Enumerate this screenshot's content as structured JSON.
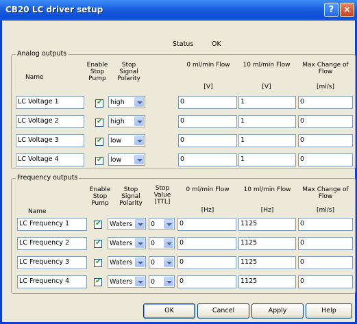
{
  "window": {
    "title": "CB20 LC driver setup",
    "help_glyph": "?",
    "close_glyph": "×"
  },
  "status": {
    "label": "Status",
    "value": "OK"
  },
  "analog": {
    "title": "Analog outputs",
    "headers": {
      "name": "Name",
      "enable_1": "Enable",
      "enable_2": "Stop",
      "enable_3": "Pump",
      "polarity_1": "Stop",
      "polarity_2": "Signal",
      "polarity_3": "Polarity",
      "flow0": "0 ml/min Flow",
      "flow0_unit": "[V]",
      "flow10": "10 ml/min Flow",
      "flow10_unit": "[V]",
      "maxchange_1": "Max Change of",
      "maxchange_2": "Flow",
      "maxchange_unit": "[ml/s]"
    },
    "rows": [
      {
        "name": "LC Voltage 1",
        "polarity": "high",
        "flow0": "0",
        "flow10": "1",
        "maxchange": "0"
      },
      {
        "name": "LC Voltage 2",
        "polarity": "high",
        "flow0": "0",
        "flow10": "1",
        "maxchange": "0"
      },
      {
        "name": "LC Voltage 3",
        "polarity": "low",
        "flow0": "0",
        "flow10": "1",
        "maxchange": "0"
      },
      {
        "name": "LC Voltage 4",
        "polarity": "low",
        "flow0": "0",
        "flow10": "1",
        "maxchange": "0"
      }
    ]
  },
  "frequency": {
    "title": "Frequency outputs",
    "headers": {
      "name": "Name",
      "enable_1": "Enable",
      "enable_2": "Stop",
      "enable_3": "Pump",
      "polarity_1": "Stop",
      "polarity_2": "Signal",
      "polarity_3": "Polarity",
      "stopval_1": "Stop",
      "stopval_2": "Value",
      "stopval_3": "[TTL]",
      "flow0": "0 ml/min Flow",
      "flow0_unit": "[Hz]",
      "flow10": "10 ml/min Flow",
      "flow10_unit": "[Hz]",
      "maxchange_1": "Max Change of",
      "maxchange_2": "Flow",
      "maxchange_unit": "[ml/s]"
    },
    "rows": [
      {
        "name": "LC Frequency 1",
        "polarity": "Waters",
        "stop_value": "0",
        "flow0": "0",
        "flow10": "1125",
        "maxchange": "0"
      },
      {
        "name": "LC Frequency 2",
        "polarity": "Waters",
        "stop_value": "0",
        "flow0": "0",
        "flow10": "1125",
        "maxchange": "0"
      },
      {
        "name": "LC Frequency 3",
        "polarity": "Waters",
        "stop_value": "0",
        "flow0": "0",
        "flow10": "1125",
        "maxchange": "0"
      },
      {
        "name": "LC Frequency 4",
        "polarity": "Waters",
        "stop_value": "0",
        "flow0": "0",
        "flow10": "1125",
        "maxchange": "0"
      }
    ]
  },
  "buttons": {
    "ok": "OK",
    "cancel": "Cancel",
    "apply": "Apply",
    "help": "Help"
  },
  "colors": {
    "titlebar": "#0a4fd6",
    "dialog_bg": "#ece9d8",
    "checkmark": "#21a121"
  }
}
